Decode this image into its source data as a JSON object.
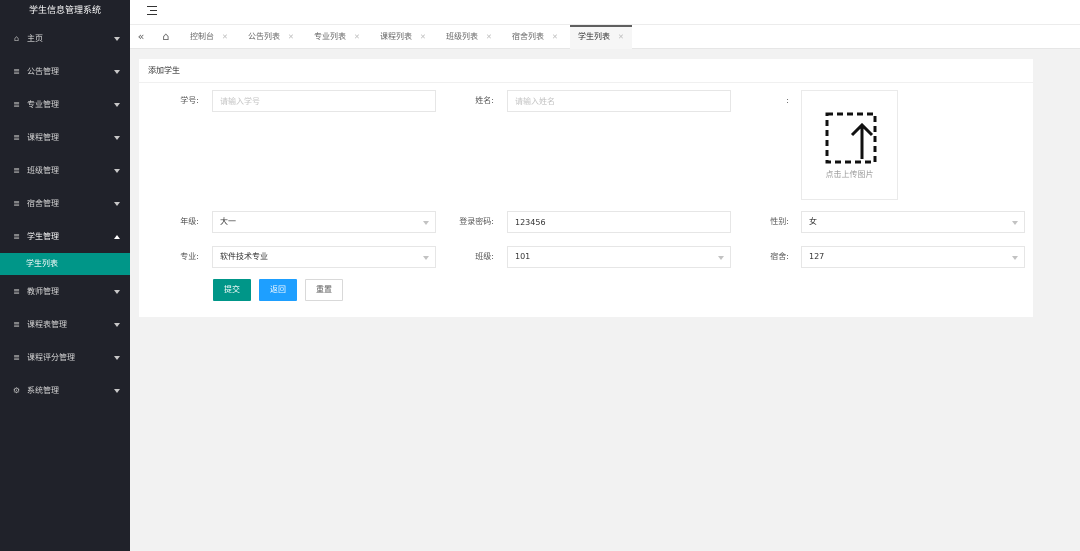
{
  "app": {
    "title": "学生信息管理系统"
  },
  "sidebar": {
    "items": [
      {
        "label": "主页",
        "icon": "home-icon"
      },
      {
        "label": "公告管理",
        "icon": "list-icon"
      },
      {
        "label": "专业管理",
        "icon": "list-icon"
      },
      {
        "label": "课程管理",
        "icon": "list-icon"
      },
      {
        "label": "班级管理",
        "icon": "list-icon"
      },
      {
        "label": "宿舍管理",
        "icon": "list-icon"
      },
      {
        "label": "学生管理",
        "icon": "list-icon",
        "expanded": true
      },
      {
        "label": "教师管理",
        "icon": "list-icon"
      },
      {
        "label": "课程表管理",
        "icon": "list-icon"
      },
      {
        "label": "课程评分管理",
        "icon": "list-icon"
      },
      {
        "label": "系统管理",
        "icon": "gear-icon"
      }
    ],
    "active_subitem": "学生列表"
  },
  "tabs": [
    {
      "label": "控制台"
    },
    {
      "label": "公告列表"
    },
    {
      "label": "专业列表"
    },
    {
      "label": "课程列表"
    },
    {
      "label": "班级列表"
    },
    {
      "label": "宿舍列表"
    },
    {
      "label": "学生列表",
      "active": true
    }
  ],
  "form": {
    "title": "添加学生",
    "student_no": {
      "label": "学号:",
      "value": "",
      "placeholder": "请输入学号"
    },
    "name": {
      "label": "姓名:",
      "value": "",
      "placeholder": "请输入姓名"
    },
    "photo": {
      "label": ":",
      "upload_text": "点击上传图片"
    },
    "grade": {
      "label": "年级:",
      "value": "大一"
    },
    "password": {
      "label": "登录密码:",
      "value": "123456"
    },
    "gender": {
      "label": "性别:",
      "value": "女"
    },
    "major": {
      "label": "专业:",
      "value": "软件技术专业"
    },
    "class": {
      "label": "班级:",
      "value": "101"
    },
    "dorm": {
      "label": "宿舍:",
      "value": "127"
    },
    "buttons": {
      "submit": "提交",
      "back": "返回",
      "reset": "重置"
    }
  },
  "colors": {
    "sidebar_bg": "#20222a",
    "accent": "#009688",
    "blue": "#1e9fff"
  }
}
